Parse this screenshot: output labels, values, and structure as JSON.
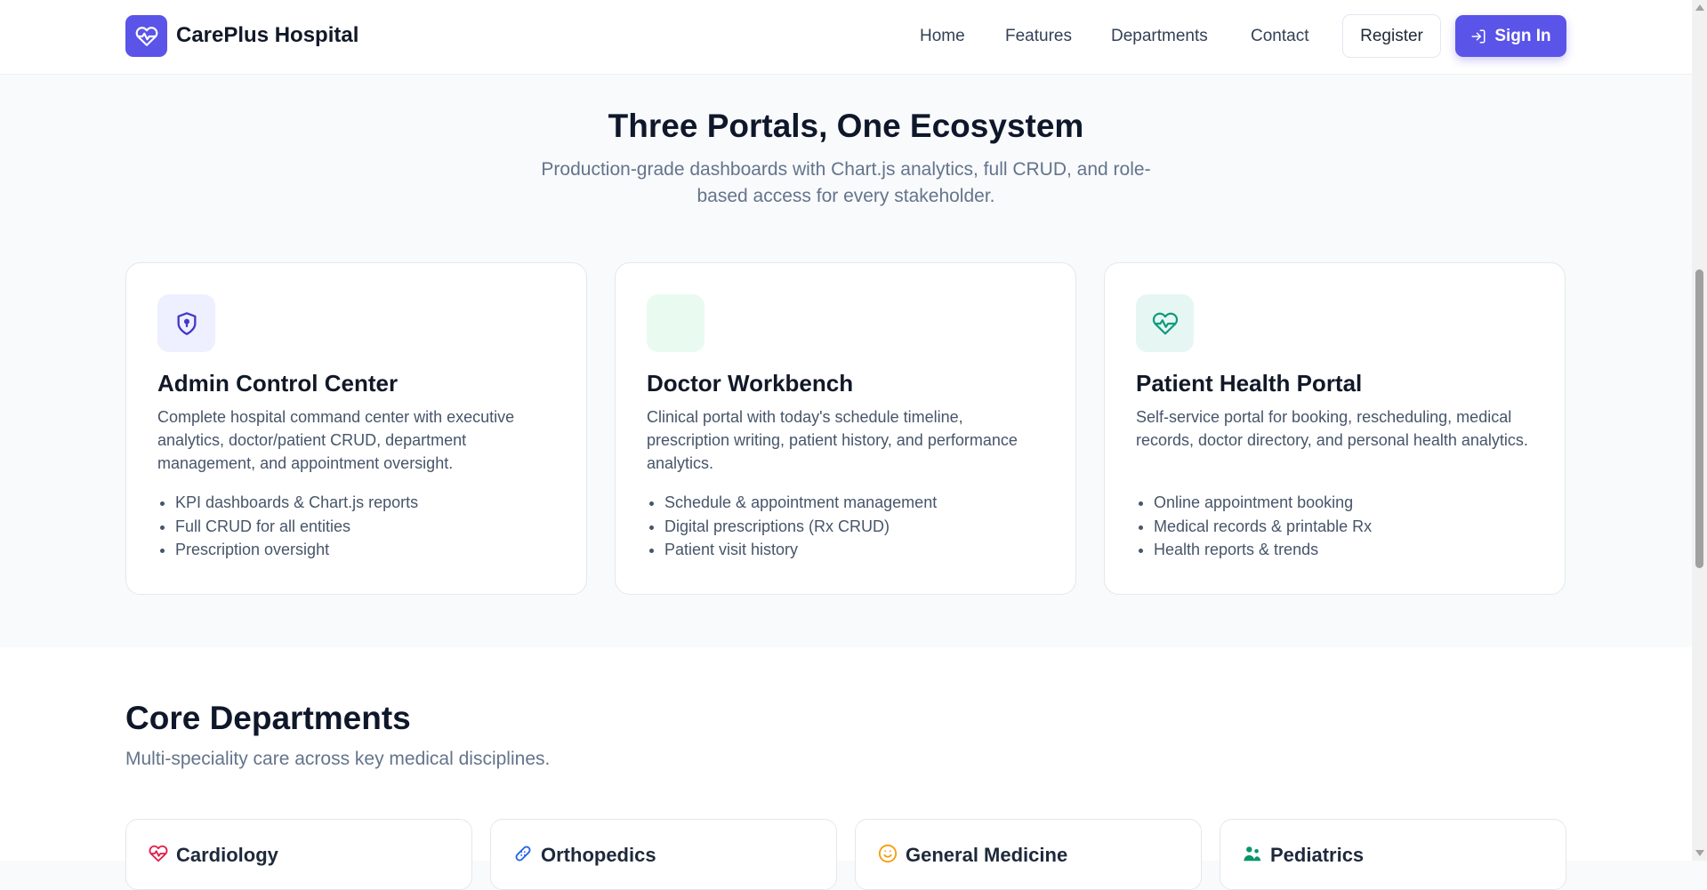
{
  "nav": {
    "brand": "CarePlus Hospital",
    "links": [
      "Home",
      "Features",
      "Departments",
      "Contact"
    ],
    "register_label": "Register",
    "signin_label": "Sign In"
  },
  "portals": {
    "title": "Three Portals, One Ecosystem",
    "subtitle": "Production-grade dashboards with Chart.js analytics, full CRUD, and role-based access for every stakeholder.",
    "cards": [
      {
        "icon": "shield-icon",
        "title": "Admin Control Center",
        "description": "Complete hospital command center with executive analytics, doctor/patient CRUD, department management, and appointment oversight.",
        "features": [
          "KPI dashboards & Chart.js reports",
          "Full CRUD for all entities",
          "Prescription oversight"
        ]
      },
      {
        "icon": "stethoscope-icon",
        "title": "Doctor Workbench",
        "description": "Clinical portal with today's schedule timeline, prescription writing, patient history, and performance analytics.",
        "features": [
          "Schedule & appointment management",
          "Digital prescriptions (Rx CRUD)",
          "Patient visit history"
        ]
      },
      {
        "icon": "heart-pulse-icon",
        "title": "Patient Health Portal",
        "description": "Self-service portal for booking, rescheduling, medical records, doctor directory, and personal health analytics.",
        "features": [
          "Online appointment booking",
          "Medical records & printable Rx",
          "Health reports & trends"
        ]
      }
    ]
  },
  "departments": {
    "title": "Core Departments",
    "subtitle": "Multi-speciality care across key medical disciplines.",
    "items": [
      {
        "name": "Cardiology",
        "icon": "heart-icon"
      },
      {
        "name": "Orthopedics",
        "icon": "bandage-icon"
      },
      {
        "name": "General Medicine",
        "icon": "smile-icon"
      },
      {
        "name": "Pediatrics",
        "icon": "family-icon"
      }
    ]
  },
  "colors": {
    "accent": "#5b54e8",
    "admin_icon_bg": "#eef0ff",
    "doctor_icon_bg": "#e9fbf0",
    "patient_icon_bg": "#e6f7f3",
    "patient_icon": "#0f9a7e",
    "cardiology": "#e11d48",
    "orthopedics": "#2563eb",
    "general_medicine": "#f59e0b",
    "pediatrics": "#059669"
  }
}
